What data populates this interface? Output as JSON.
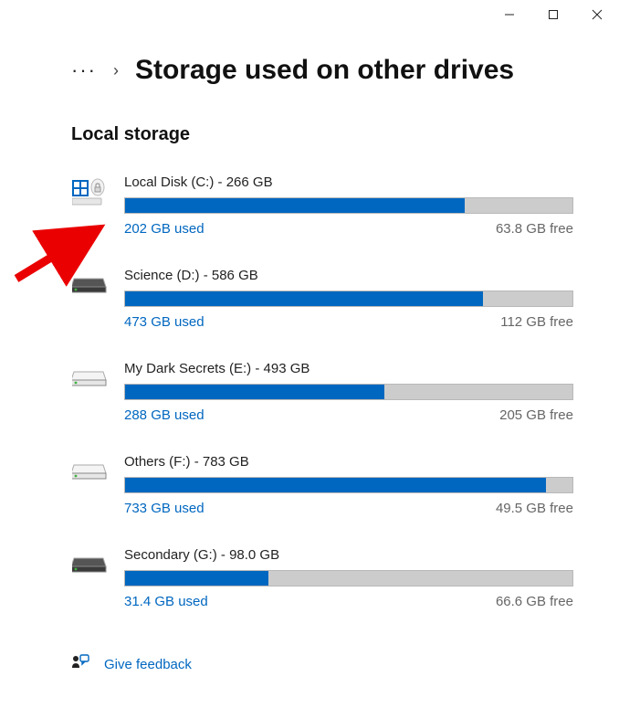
{
  "window": {
    "minimize": "minimize",
    "maximize": "maximize",
    "close": "close"
  },
  "breadcrumb": {
    "ellipsis": "···",
    "chevron": "›",
    "title": "Storage used on other drives"
  },
  "section_title": "Local storage",
  "drives": [
    {
      "icon": "system",
      "name": "Local Disk (C:)",
      "total": "266 GB",
      "used": "202 GB used",
      "free": "63.8 GB free",
      "fill_pct": 76
    },
    {
      "icon": "hdd-dark",
      "name": "Science (D:)",
      "total": "586 GB",
      "used": "473 GB used",
      "free": "112 GB free",
      "fill_pct": 80
    },
    {
      "icon": "hdd",
      "name": "My Dark Secrets (E:)",
      "total": "493 GB",
      "used": "288 GB used",
      "free": "205 GB free",
      "fill_pct": 58
    },
    {
      "icon": "hdd",
      "name": "Others (F:)",
      "total": "783 GB",
      "used": "733 GB used",
      "free": "49.5 GB free",
      "fill_pct": 94
    },
    {
      "icon": "hdd-dark",
      "name": "Secondary (G:)",
      "total": "98.0 GB",
      "used": "31.4 GB used",
      "free": "66.6 GB free",
      "fill_pct": 32
    }
  ],
  "feedback_label": "Give feedback",
  "colors": {
    "accent": "#0067c0",
    "bar_bg": "#cccccc"
  }
}
